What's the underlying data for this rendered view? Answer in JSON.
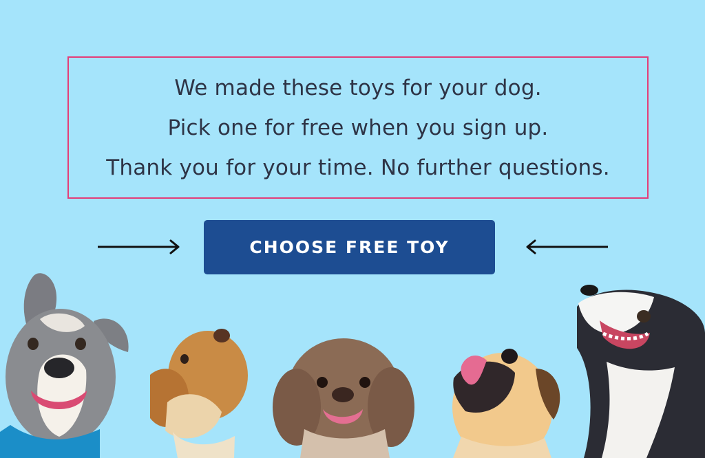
{
  "message": {
    "lines": [
      "We made these toys for your dog.",
      "Pick one for free when you sign up.",
      "Thank you for your time. No further questions."
    ]
  },
  "cta": {
    "label": "CHOOSE FREE TOY"
  },
  "colors": {
    "background": "#a5e4fb",
    "frame": "#e43d78",
    "button": "#1d4d92",
    "button_text": "#ffffff",
    "text": "#2e3446"
  },
  "icons": {
    "left": "right-arrow-icon",
    "right": "left-arrow-icon"
  }
}
